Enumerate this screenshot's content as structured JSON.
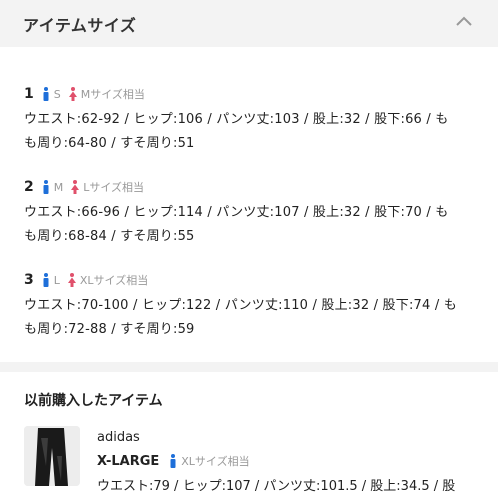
{
  "header": {
    "title": "アイテムサイズ",
    "chevron_icon": "chevron-up-icon"
  },
  "sizes": [
    {
      "num": "1",
      "male": "S",
      "female": "Mサイズ相当",
      "line1": "ウエスト:62-92 / ヒップ:106 / パンツ丈:103 / 股上:32 / 股下:66 / も",
      "line2": "も周り:64-80 / すそ周り:51"
    },
    {
      "num": "2",
      "male": "M",
      "female": "Lサイズ相当",
      "line1": "ウエスト:66-96 / ヒップ:114 / パンツ丈:107 / 股上:32 / 股下:70 / も",
      "line2": "も周り:68-84 / すそ周り:55"
    },
    {
      "num": "3",
      "male": "L",
      "female": "XLサイズ相当",
      "line1": "ウエスト:70-100 / ヒップ:122 / パンツ丈:110 / 股上:32 / 股下:74 / も",
      "line2": "も周り:72-88 / すそ周り:59"
    }
  ],
  "previous": {
    "title": "以前購入したアイテム",
    "brand": "adidas",
    "size": "X-LARGE",
    "size_equiv": "XLサイズ相当",
    "measure": "ウエスト:79 / ヒップ:107 / パンツ丈:101.5 / 股上:34.5 / 股"
  },
  "colors": {
    "male": "#1e6fd9",
    "female": "#e0506b",
    "panel": "#f3f3f3"
  }
}
